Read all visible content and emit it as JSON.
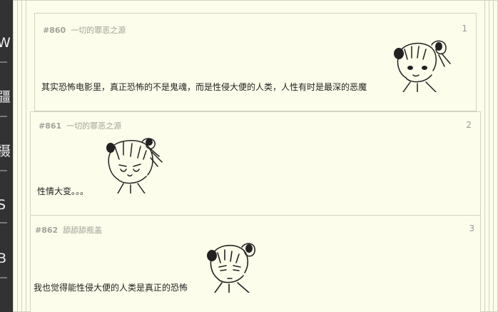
{
  "background_hints": [
    "W",
    "疆",
    "摄",
    "S",
    "B"
  ],
  "posts": [
    {
      "id": "#860",
      "author": "一切的罪恶之源",
      "floor": "1",
      "text": "其实恐怖电影里，真正恐怖的不是鬼魂，而是性侵大便的人类，人性有时是最深的恶魔",
      "sticker": "anime-girl-sticker"
    },
    {
      "id": "#861",
      "author": "一切的罪恶之源",
      "floor": "2",
      "text": "性情大变。。。",
      "sticker": "anime-girl-sticker-crying"
    },
    {
      "id": "#862",
      "author": "舔舔舔瓶盖",
      "floor": "3",
      "text": "我也觉得能性侵大便的人类是真正的恐怖",
      "sticker": "anime-girl-sticker-serious"
    }
  ],
  "colors": {
    "background": "#323232",
    "card": "#fdfdeb",
    "border": "#d3d3c0",
    "meta": "#a2a29a",
    "text": "#222222"
  }
}
